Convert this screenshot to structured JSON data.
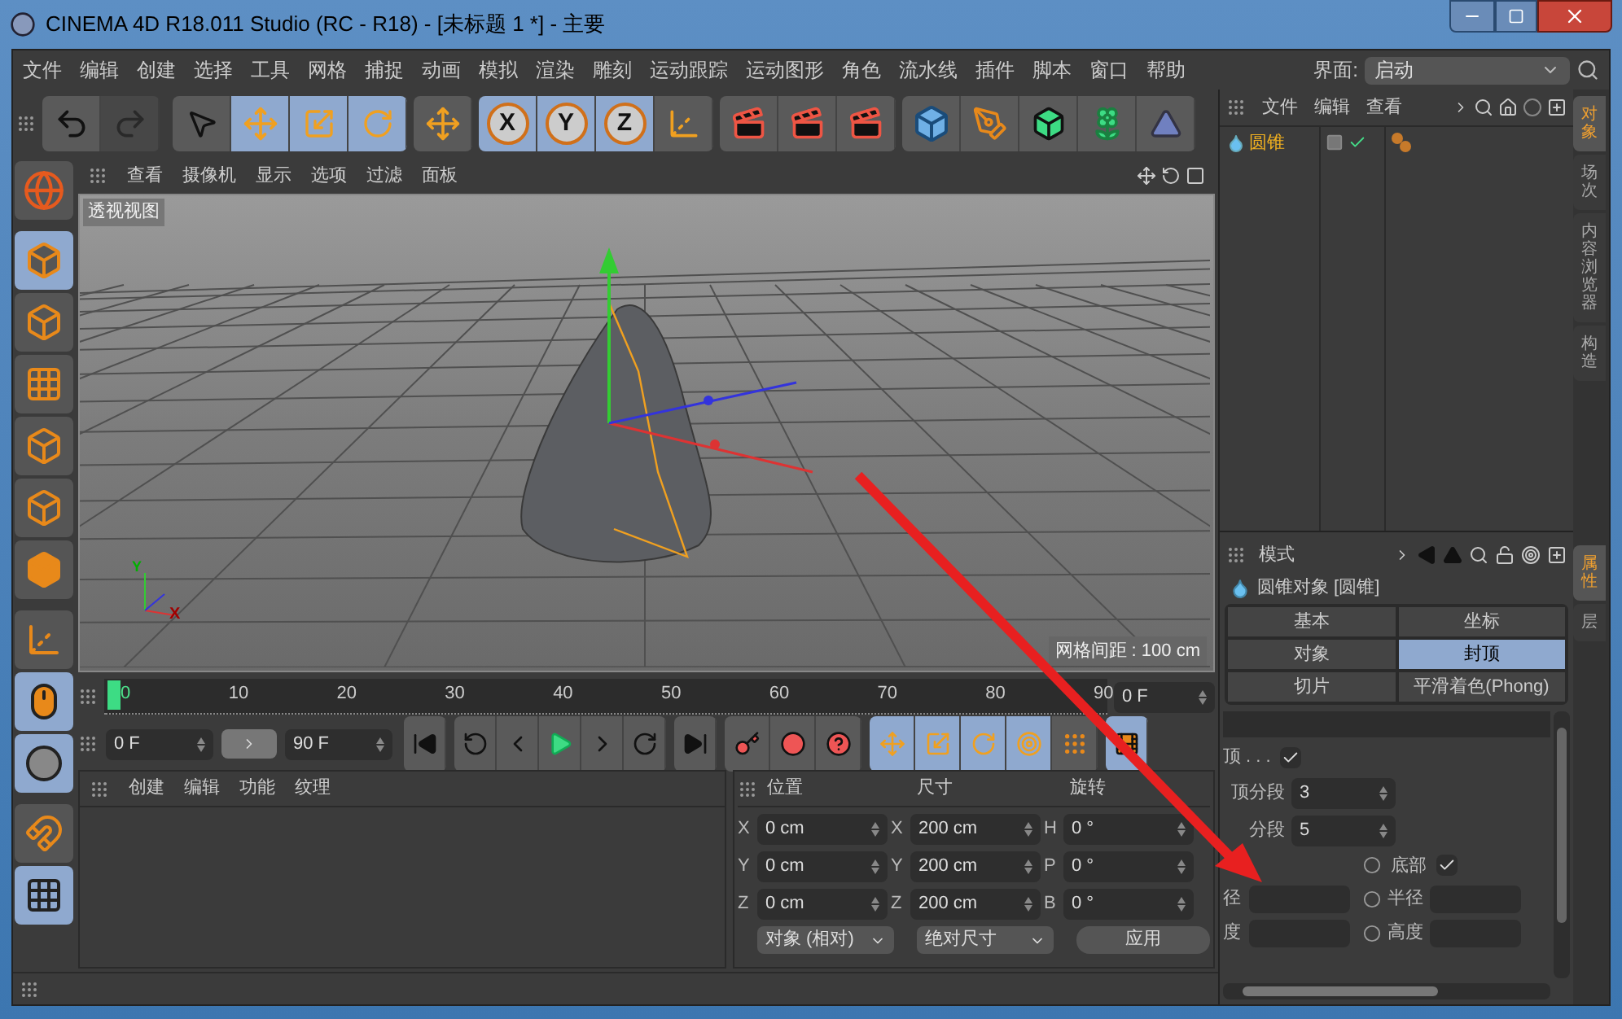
{
  "window": {
    "title": "CINEMA 4D R18.011 Studio (RC - R18) - [未标题 1 *] - 主要"
  },
  "menu": [
    "文件",
    "编辑",
    "创建",
    "选择",
    "工具",
    "网格",
    "捕捉",
    "动画",
    "模拟",
    "渲染",
    "雕刻",
    "运动跟踪",
    "运动图形",
    "角色",
    "流水线",
    "插件",
    "脚本",
    "窗口",
    "帮助"
  ],
  "layout": {
    "label": "界面:",
    "value": "启动"
  },
  "history": [
    {
      "disabled": false
    },
    {
      "disabled": true
    }
  ],
  "tools": [
    {
      "selected": false
    },
    {
      "selected": true
    },
    {
      "selected": true
    },
    {
      "selected": true
    }
  ],
  "transform_tool": {
    "selected": false
  },
  "axes": [
    {
      "label": "X",
      "selected": true
    },
    {
      "label": "Y",
      "selected": true
    },
    {
      "label": "Z",
      "selected": true
    }
  ],
  "world_coords": {
    "selected": false
  },
  "left_tools": [
    {
      "selected": false
    },
    {
      "selected": true
    },
    {
      "selected": false
    },
    {
      "selected": false
    },
    {
      "selected": false
    },
    {
      "selected": false
    },
    {
      "selected": false
    },
    {
      "selected": false
    },
    {
      "selected": true
    },
    {
      "selected": true
    },
    {
      "selected": false
    },
    {
      "selected": true
    }
  ],
  "viewport": {
    "menu": [
      "查看",
      "摄像机",
      "显示",
      "选项",
      "过滤",
      "面板"
    ],
    "view_name": "透视视图",
    "gizmo_labels": [
      "Y",
      "X"
    ],
    "grid_info": "网格间距 : 100 cm"
  },
  "timeline": {
    "ticks": [
      "0",
      "10",
      "20",
      "30",
      "40",
      "50",
      "60",
      "70",
      "80",
      "90"
    ],
    "current": "0 F"
  },
  "transport": {
    "start": "0 F",
    "end": "90 F",
    "tools": [
      {
        "selected": true
      },
      {
        "selected": true
      },
      {
        "selected": true
      },
      {
        "selected": true
      },
      {
        "selected": false
      }
    ],
    "timeline_toggle": {
      "selected": true
    }
  },
  "material_manager": {
    "menu": [
      "创建",
      "编辑",
      "功能",
      "纹理"
    ]
  },
  "coordinates": {
    "headers": [
      "位置",
      "尺寸",
      "旋转"
    ],
    "rows": [
      {
        "pos_axis": "X",
        "pos": "0 cm",
        "size_axis": "X",
        "size": "200 cm",
        "rot_axis": "H",
        "rot": "0 °"
      },
      {
        "pos_axis": "Y",
        "pos": "0 cm",
        "size_axis": "Y",
        "size": "200 cm",
        "rot_axis": "P",
        "rot": "0 °"
      },
      {
        "pos_axis": "Z",
        "pos": "0 cm",
        "size_axis": "Z",
        "size": "200 cm",
        "rot_axis": "B",
        "rot": "0 °"
      }
    ],
    "mode": "对象 (相对)",
    "size_mode": "绝对尺寸",
    "apply": "应用"
  },
  "object_manager": {
    "menu": [
      "文件",
      "编辑",
      "查看"
    ],
    "objects": [
      {
        "name": "圆锥",
        "selected": true
      }
    ]
  },
  "attributes": {
    "menu": [
      "模式"
    ],
    "title": "圆锥对象 [圆锥]",
    "tabs": [
      {
        "label": "基本",
        "selected": false
      },
      {
        "label": "坐标",
        "selected": false
      },
      {
        "label": "对象",
        "selected": false
      },
      {
        "label": "封顶",
        "selected": true
      },
      {
        "label": "切片",
        "selected": false
      },
      {
        "label": "平滑着色(Phong)",
        "selected": false
      }
    ],
    "fields": [
      {
        "kind": "check",
        "label": "顶 . . .",
        "checked": true
      },
      {
        "kind": "number",
        "label": "顶分段",
        "value": "3"
      },
      {
        "kind": "number",
        "label": "分段",
        "value": "5"
      },
      {
        "kind": "sub_check",
        "label": "底部",
        "checked": true
      },
      {
        "kind": "pair",
        "left": "径",
        "right": "半径"
      },
      {
        "kind": "pair",
        "left": "度",
        "right": "高度"
      }
    ]
  },
  "side_tabs": {
    "top": [
      {
        "label": "对象",
        "selected": true
      },
      {
        "label": "场次",
        "selected": false
      },
      {
        "label": "内容浏览器",
        "selected": false
      },
      {
        "label": "构造",
        "selected": false
      }
    ],
    "bottom": [
      {
        "label": "属性",
        "selected": true
      },
      {
        "label": "层",
        "selected": false
      }
    ]
  }
}
